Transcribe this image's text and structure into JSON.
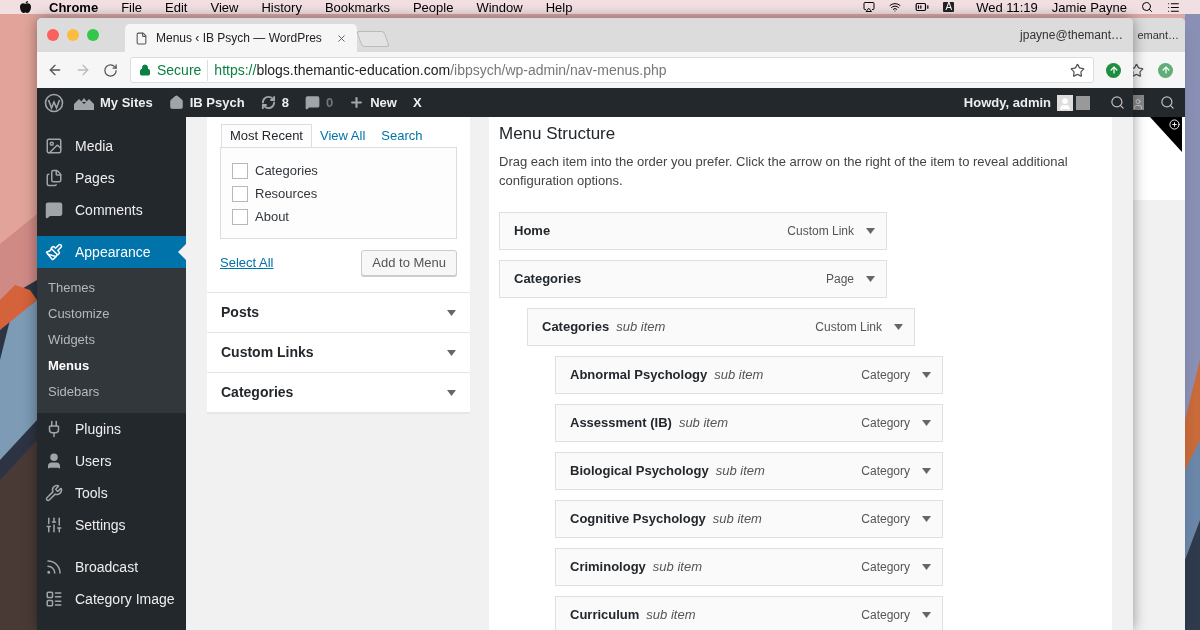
{
  "desktop_menubar": {
    "app": "Chrome",
    "menus": [
      "File",
      "Edit",
      "View",
      "History",
      "Bookmarks",
      "People",
      "Window",
      "Help"
    ],
    "input_source": "A",
    "clock": "Wed 11:19",
    "user": "Jamie Payne"
  },
  "background_window": {
    "profile": "emant…"
  },
  "browser": {
    "tab_title": "Menus ‹ IB Psych — WordPres",
    "profile": "jpayne@themant…",
    "secure_label": "Secure",
    "url_scheme": "https://",
    "url_host": "blogs.themantic-education.com",
    "url_path": "/ibpsych/wp-admin/nav-menus.php"
  },
  "admin_bar": {
    "items": [
      {
        "kind": "wp-logo"
      },
      {
        "kind": "sites",
        "label": "My Sites"
      },
      {
        "kind": "home",
        "label": "IB Psych"
      },
      {
        "kind": "updates",
        "label": "8"
      },
      {
        "kind": "comments",
        "label": "0"
      },
      {
        "kind": "new",
        "label": "New"
      },
      {
        "kind": "text",
        "label": "X"
      }
    ],
    "greeting": "Howdy, admin"
  },
  "sidebar": {
    "sections": [
      {
        "items": [
          {
            "kind": "media",
            "label": "Media",
            "selected": false
          },
          {
            "kind": "pages",
            "label": "Pages",
            "selected": false
          },
          {
            "kind": "comments",
            "label": "Comments",
            "selected": false
          }
        ]
      },
      {
        "items": [
          {
            "kind": "appearance",
            "label": "Appearance",
            "selected": true,
            "submenu": [
              {
                "label": "Themes",
                "selected": false
              },
              {
                "label": "Customize",
                "selected": false
              },
              {
                "label": "Widgets",
                "selected": false
              },
              {
                "label": "Menus",
                "selected": true
              },
              {
                "label": "Sidebars",
                "selected": false
              }
            ]
          },
          {
            "kind": "plugins",
            "label": "Plugins",
            "selected": false
          },
          {
            "kind": "users",
            "label": "Users",
            "selected": false
          },
          {
            "kind": "tools",
            "label": "Tools",
            "selected": false
          },
          {
            "kind": "settings",
            "label": "Settings",
            "selected": false
          }
        ]
      },
      {
        "items": [
          {
            "kind": "broadcast",
            "label": "Broadcast",
            "selected": false
          },
          {
            "kind": "category-image",
            "label": "Category Image",
            "selected": false
          }
        ]
      }
    ]
  },
  "add_items": {
    "tabs": [
      {
        "label": "Most Recent",
        "selected": true
      },
      {
        "label": "View All",
        "selected": false
      },
      {
        "label": "Search",
        "selected": false
      }
    ],
    "options": [
      {
        "label": "Categories",
        "checked": false
      },
      {
        "label": "Resources",
        "checked": false
      },
      {
        "label": "About",
        "checked": false
      }
    ],
    "select_all": "Select All",
    "add_button": "Add to Menu",
    "sections": [
      {
        "title": "Posts",
        "expanded": false
      },
      {
        "title": "Custom Links",
        "expanded": false
      },
      {
        "title": "Categories",
        "expanded": false
      }
    ]
  },
  "menu_structure": {
    "title": "Menu Structure",
    "description": "Drag each item into the order you prefer. Click the arrow on the right of the item to reveal additional configuration options.",
    "items": [
      {
        "title": "Home",
        "type": "Custom Link"
      },
      {
        "title": "Categories",
        "type": "Page",
        "children": [
          {
            "title": "Categories",
            "sub_label": "sub item",
            "type": "Custom Link",
            "children": [
              {
                "title": "Abnormal Psychology",
                "sub_label": "sub item",
                "type": "Category"
              },
              {
                "title": "Assessment (IB)",
                "sub_label": "sub item",
                "type": "Category"
              },
              {
                "title": "Biological Psychology",
                "sub_label": "sub item",
                "type": "Category"
              },
              {
                "title": "Cognitive Psychology",
                "sub_label": "sub item",
                "type": "Category"
              },
              {
                "title": "Criminology",
                "sub_label": "sub item",
                "type": "Category"
              },
              {
                "title": "Curriculum",
                "sub_label": "sub item",
                "type": "Category"
              }
            ]
          }
        ]
      }
    ]
  }
}
